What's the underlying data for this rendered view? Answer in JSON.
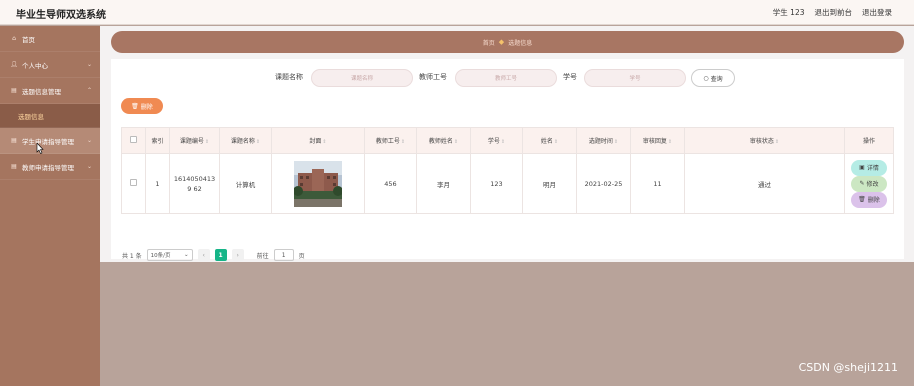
{
  "app": {
    "title": "毕业生导师双选系统"
  },
  "topnav": {
    "user": "学生 123",
    "back_front": "退出到前台",
    "logout": "退出登录"
  },
  "sidebar": {
    "items": [
      {
        "label": "首页",
        "icon": "home-icon"
      },
      {
        "label": "个人中心",
        "icon": "user-icon"
      },
      {
        "label": "选题信息管理",
        "icon": "document-icon"
      },
      {
        "label": "选题信息",
        "icon": ""
      },
      {
        "label": "学生申请指导管理",
        "icon": "document-icon"
      },
      {
        "label": "教师申请指导管理",
        "icon": "document-icon"
      }
    ]
  },
  "breadcrumb": {
    "home": "首页",
    "current": "选题信息"
  },
  "search": {
    "topic_label": "课题名称",
    "topic_placeholder": "课题名称",
    "teacher_label": "教师工号",
    "teacher_placeholder": "教师工号",
    "student_label": "学号",
    "student_placeholder": "学号",
    "search_button": "查询"
  },
  "toolbar": {
    "delete_label": "删除"
  },
  "table": {
    "headers": [
      "索引",
      "课题编号",
      "课题名称",
      "封面",
      "教师工号",
      "教师姓名",
      "学号",
      "姓名",
      "选题时间",
      "审核回复",
      "审核状态",
      "操作"
    ],
    "rows": [
      {
        "index": "1",
        "topic_no": "16140504139 62",
        "topic_name": "计算机",
        "teacher_no": "456",
        "teacher_name": "李月",
        "student_no": "123",
        "student_name": "明月",
        "time": "2021-02-25",
        "reply": "11",
        "status": "通过"
      }
    ],
    "actions": {
      "detail": "详情",
      "edit": "修改",
      "delete": "删除"
    }
  },
  "pagination": {
    "total": "共 1 条",
    "page_size": "10条/页",
    "current_page": "1",
    "goto_label": "前往",
    "goto_value": "1",
    "page_unit": "页"
  },
  "watermark": "CSDN @sheji1211",
  "colors": {
    "accent": "#a87663",
    "sidebar": "#a5755f",
    "delete_button": "#f08a52",
    "pager_active": "#16b588"
  }
}
